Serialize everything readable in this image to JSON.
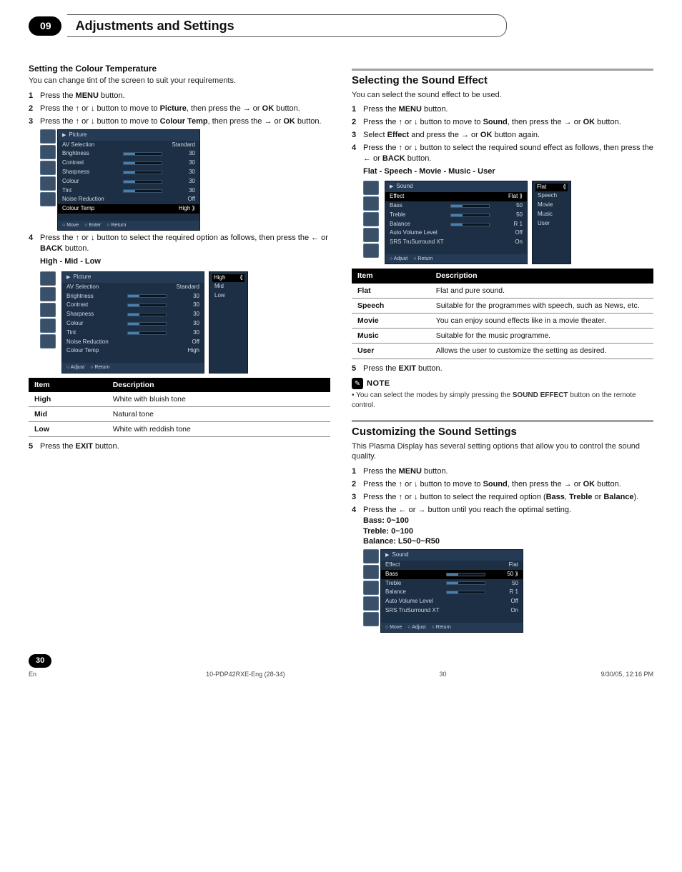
{
  "header": {
    "chapter_no": "09",
    "chapter_title": "Adjustments and Settings"
  },
  "left": {
    "subsection": "Setting the Colour Temperature",
    "intro": "You can change tint of the screen to suit your requirements.",
    "step1": "Press the MENU button.",
    "step2": "Press the ↑ or ↓ button to move to Picture, then press the → or OK button.",
    "step3": "Press the ↑ or ↓ button to move to Colour Temp, then press the → or OK button.",
    "step4": "Press the ↑ or ↓ button to select the required option as follows, then press the ← or BACK button.",
    "options": "High - Mid - Low",
    "step5": "Press the EXIT button.",
    "table": {
      "col1": "Item",
      "col2": "Description",
      "rows": [
        {
          "k": "High",
          "v": "White with bluish tone"
        },
        {
          "k": "Mid",
          "v": "Natural tone"
        },
        {
          "k": "Low",
          "v": "White with reddish tone"
        }
      ]
    },
    "osd1": {
      "title": "Picture",
      "rows": [
        {
          "lbl": "AV Selection",
          "val": "Standard",
          "bar": false
        },
        {
          "lbl": "Brightness",
          "val": "30",
          "bar": true
        },
        {
          "lbl": "Contrast",
          "val": "30",
          "bar": true
        },
        {
          "lbl": "Sharpness",
          "val": "30",
          "bar": true
        },
        {
          "lbl": "Colour",
          "val": "30",
          "bar": true
        },
        {
          "lbl": "Tint",
          "val": "30",
          "bar": true
        },
        {
          "lbl": "Noise Reduction",
          "val": "Off",
          "bar": false
        },
        {
          "lbl": "Colour Temp",
          "val": "High",
          "bar": false,
          "hl": true
        }
      ],
      "foot": [
        "Move",
        "Enter",
        "Return"
      ]
    },
    "osd2_popup": [
      "High",
      "Mid",
      "Low"
    ],
    "osd2_foot": [
      "Adjust",
      "Return"
    ]
  },
  "right_a": {
    "section": "Selecting the Sound Effect",
    "intro": "You can select the sound effect to be used.",
    "step1": "Press the MENU button.",
    "step2": "Press the ↑ or ↓ button to move to Sound, then press the → or OK button.",
    "step3": "Select Effect and press the → or OK button again.",
    "step4": "Press the ↑ or ↓ button to select the required sound effect as follows, then press the ← or BACK button.",
    "options": "Flat - Speech - Movie - Music - User",
    "step5": "Press the EXIT button.",
    "table": {
      "col1": "Item",
      "col2": "Description",
      "rows": [
        {
          "k": "Flat",
          "v": "Flat and pure sound."
        },
        {
          "k": "Speech",
          "v": "Suitable for the programmes with speech, such as News, etc."
        },
        {
          "k": "Movie",
          "v": "You can enjoy sound effects like in a movie theater."
        },
        {
          "k": "Music",
          "v": "Suitable for the music programme."
        },
        {
          "k": "User",
          "v": "Allows the user to customize the setting as desired."
        }
      ]
    },
    "osd": {
      "title": "Sound",
      "rows": [
        {
          "lbl": "Effect",
          "val": "Flat",
          "bar": false,
          "hl": true
        },
        {
          "lbl": "Bass",
          "val": "50",
          "bar": true
        },
        {
          "lbl": "Treble",
          "val": "50",
          "bar": true
        },
        {
          "lbl": "Balance",
          "val": "R 1",
          "bar": true
        },
        {
          "lbl": "Auto Volume Level",
          "val": "Off",
          "bar": false
        },
        {
          "lbl": "SRS TruSurround XT",
          "val": "On",
          "bar": false
        }
      ],
      "foot": [
        "Adjust",
        "Return"
      ]
    },
    "osd_popup": [
      "Flat",
      "Speech",
      "Movie",
      "Music",
      "User"
    ],
    "note_label": "NOTE",
    "note": "You can select the modes by simply pressing the SOUND EFFECT button on the remote control."
  },
  "right_b": {
    "section": "Customizing the Sound Settings",
    "intro": "This Plasma Display has several setting options that allow you to control the sound quality.",
    "step1": "Press the MENU button.",
    "step2": "Press the ↑ or ↓ button to move to Sound, then press the → or OK button.",
    "step3": "Press the ↑ or ↓ button to select the required option (Bass, Treble or Balance).",
    "step4": "Press the ← or → button until you reach the optimal setting.",
    "range1": "Bass: 0~100",
    "range2": "Treble: 0~100",
    "range3": "Balance: L50~0~R50",
    "osd": {
      "title": "Sound",
      "rows": [
        {
          "lbl": "Effect",
          "val": "Flat",
          "bar": false
        },
        {
          "lbl": "Bass",
          "val": "50",
          "bar": true,
          "hl": true
        },
        {
          "lbl": "Treble",
          "val": "50",
          "bar": true
        },
        {
          "lbl": "Balance",
          "val": "R 1",
          "bar": true
        },
        {
          "lbl": "Auto Volume Level",
          "val": "Off",
          "bar": false
        },
        {
          "lbl": "SRS TruSurround XT",
          "val": "On",
          "bar": false
        }
      ],
      "foot": [
        "Move",
        "Adjust",
        "Return"
      ]
    }
  },
  "footer": {
    "page": "30",
    "lang": "En",
    "file": "10-PDP42RXE-Eng (28-34)",
    "printpage": "30",
    "timestamp": "9/30/05, 12:16 PM"
  }
}
